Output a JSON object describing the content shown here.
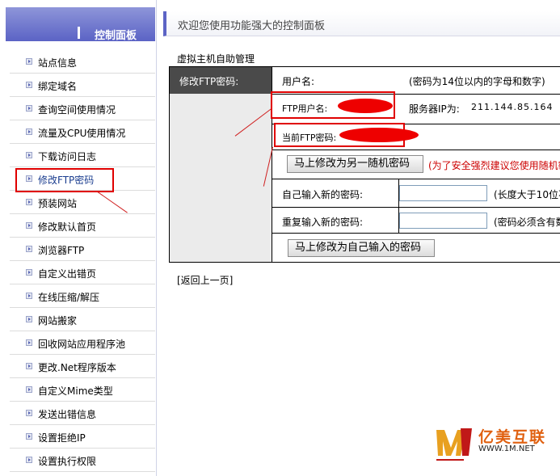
{
  "sidebar": {
    "title": "控制面板",
    "items": [
      {
        "label": "站点信息"
      },
      {
        "label": "绑定域名"
      },
      {
        "label": "查询空间使用情况"
      },
      {
        "label": "流量及CPU使用情况"
      },
      {
        "label": "下载访问日志"
      },
      {
        "label": "修改FTP密码",
        "active": true
      },
      {
        "label": "预装网站"
      },
      {
        "label": "修改默认首页"
      },
      {
        "label": "浏览器FTP"
      },
      {
        "label": "自定义出错页"
      },
      {
        "label": "在线压缩/解压"
      },
      {
        "label": "网站搬家"
      },
      {
        "label": "回收网站应用程序池"
      },
      {
        "label": "更改.Net程序版本"
      },
      {
        "label": "自定义Mime类型"
      },
      {
        "label": "发送出错信息"
      },
      {
        "label": "设置拒绝IP"
      },
      {
        "label": "设置执行权限"
      }
    ]
  },
  "header": {
    "title": "欢迎您使用功能强大的控制面板"
  },
  "section": {
    "title": "虚拟主机自助管理"
  },
  "form": {
    "row_header": "修改FTP密码:",
    "username_label": "用户名:",
    "username_hint": "(密码为14位以内的字母和数字)",
    "ftp_user_label": "FTP用户名:",
    "server_ip_label": "服务器IP为:",
    "server_ip": "211.144.85.164",
    "current_pwd_label": "当前FTP密码:",
    "random_button": "马上修改为另一随机密码",
    "random_hint": "(为了安全强烈建议您使用随机密",
    "new_pwd_label": "自己输入新的密码:",
    "new_pwd_value": "",
    "new_pwd_hint": "(长度大于10位不",
    "repeat_pwd_label": "重复输入新的密码:",
    "repeat_pwd_value": "",
    "repeat_pwd_hint": "(密码必须含有数",
    "own_button": "马上修改为自己输入的密码"
  },
  "back_link": "[返回上一页]",
  "logo": {
    "name": "亿美互联",
    "url": "WWW.1M.NET"
  },
  "colors": {
    "accent": "#5c64c5",
    "row_header_bg": "#4a4a4a",
    "annotation_red": "#e00000",
    "warning_text": "#cc0000"
  }
}
